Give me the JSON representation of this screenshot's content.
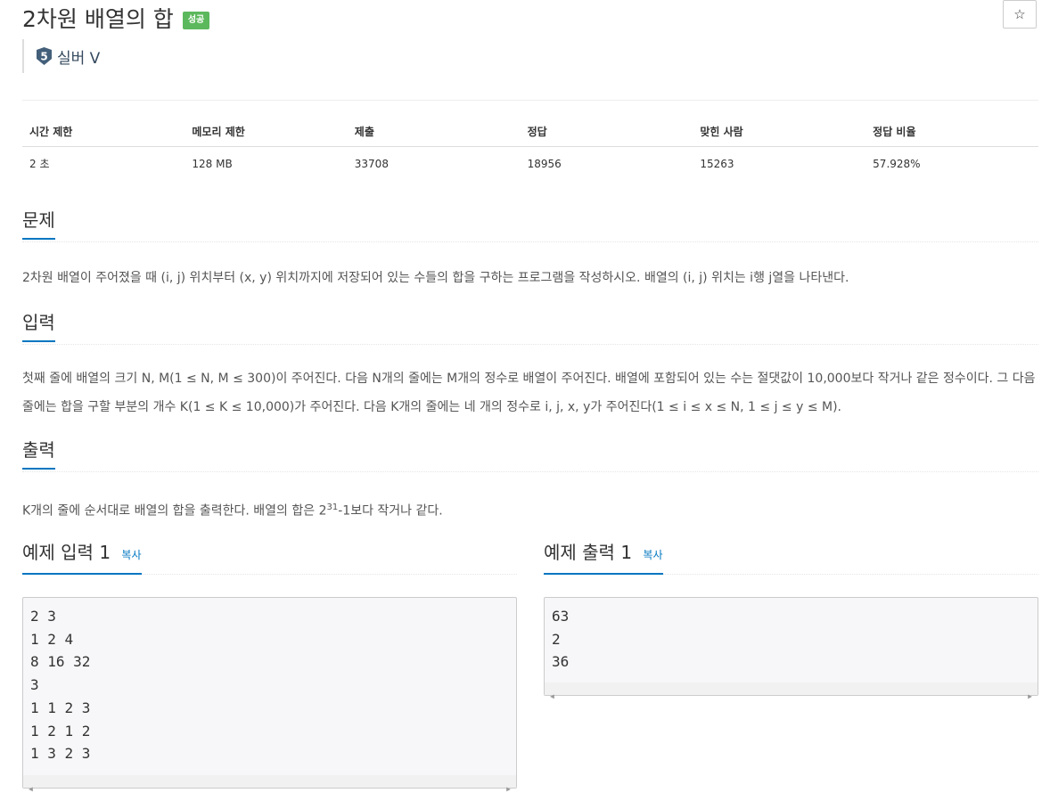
{
  "problem": {
    "title": "2차원 배열의 합",
    "status_badge": "성공",
    "star": "☆",
    "tier": {
      "number": "5",
      "label": "실버 V"
    }
  },
  "info_table": {
    "headers": [
      "시간 제한",
      "메모리 제한",
      "제출",
      "정답",
      "맞힌 사람",
      "정답 비율"
    ],
    "values": [
      "2 초",
      "128 MB",
      "33708",
      "18956",
      "15263",
      "57.928%"
    ]
  },
  "sections": {
    "problem_heading": "문제",
    "problem_text": "2차원 배열이 주어졌을 때 (i, j) 위치부터 (x, y) 위치까지에 저장되어 있는 수들의 합을 구하는 프로그램을 작성하시오. 배열의 (i, j) 위치는 i행 j열을 나타낸다.",
    "input_heading": "입력",
    "input_text": "첫째 줄에 배열의 크기 N, M(1 ≤ N, M ≤ 300)이 주어진다. 다음 N개의 줄에는 M개의 정수로 배열이 주어진다. 배열에 포함되어 있는 수는 절댓값이 10,000보다 작거나 같은 정수이다. 그 다음 줄에는 합을 구할 부분의 개수 K(1 ≤ K ≤ 10,000)가 주어진다. 다음 K개의 줄에는 네 개의 정수로 i, j, x, y가 주어진다(1 ≤ i ≤ x ≤ N, 1 ≤ j ≤ y ≤ M).",
    "output_heading": "출력",
    "output_text_before": "K개의 줄에 순서대로 배열의 합을 출력한다. 배열의 합은 2",
    "output_text_sup": "31",
    "output_text_after": "-1보다 작거나 같다."
  },
  "examples": {
    "input_heading": "예제 입력 1",
    "output_heading": "예제 출력 1",
    "copy_label": "복사",
    "input_body": "2 3\n1 2 4\n8 16 32\n3\n1 1 2 3\n1 2 1 2\n1 3 2 3",
    "output_body": "63\n2\n36"
  },
  "colors": {
    "accent": "#0076c0",
    "badge": "#5cb85c",
    "tier": "#34495e"
  }
}
